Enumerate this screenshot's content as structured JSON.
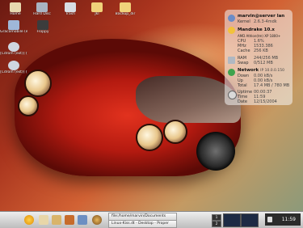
{
  "desktop_icons": [
    {
      "label": "Home",
      "icon": "home-icon"
    },
    {
      "label": "Hard Disc",
      "icon": "hard-disk-icon"
    },
    {
      "label": "Trash",
      "icon": "trash-icon"
    },
    {
      "label": "Jkl",
      "icon": "folder-icon"
    },
    {
      "label": "Backup_dir",
      "icon": "folder-icon"
    },
    {
      "label": "Gracomobile (ext.) gl",
      "icon": "network-drive-icon"
    },
    {
      "label": "Floppy",
      "icon": "floppy-icon"
    },
    {
      "label": "[Cdrom (ext)] (vcd.kvm)",
      "icon": "cdrom-icon"
    },
    {
      "label": "[Cdrom (ext)] (vcd.kvm)",
      "icon": "cdrom-icon"
    }
  ],
  "monitor": {
    "user_host": "marvin@server lan",
    "kernel_label": "Kernel",
    "kernel": "2.6.3-4mdk",
    "distro": "Mandrake 10.x",
    "cpu_model": "AMD Athlon(tm) XP 1800+",
    "cpu_label": "CPU",
    "cpu": "1.6%",
    "mhz_label": "MHz",
    "mhz": "1533.386",
    "cache_label": "Cache",
    "cache": "256 KB",
    "ram_label": "RAM",
    "ram": "244/256 MB",
    "swap_label": "Swap",
    "swap": "0/512 MB",
    "network_label": "Network",
    "ip": "IP 10.0.0.150",
    "down_label": "Down",
    "down": "0.00 kB/s",
    "up_label": "Up",
    "up": "0.00 kB/s",
    "total_label": "Total",
    "total": "17.4 MB / 780 MB",
    "uptime_label": "Uptime",
    "uptime": "00:00:37",
    "time_label": "Time",
    "time": "11:59",
    "date_label": "Date",
    "date": "12/15/2004",
    "accent": "#0a3f8a"
  },
  "taskbar": {
    "tasks": [
      "file:/home/marvin/Documents",
      "Linux-Kiss.dt - Desktop - Proper"
    ],
    "pager": [
      "1",
      "2"
    ],
    "clock": "11:59"
  }
}
